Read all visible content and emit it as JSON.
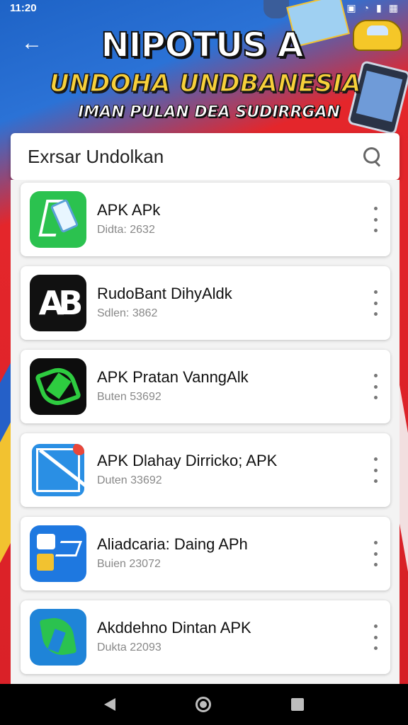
{
  "status_bar": {
    "time": "11:20",
    "icons": [
      "image-icon",
      "wifi-icon",
      "battery-icon",
      "notification-icon"
    ]
  },
  "header": {
    "back_icon": "arrow-left-icon",
    "title": "NIPOTUS A",
    "subtitle": "UNDOHA UNDBANESIA",
    "tagline": "IMAN PULAN DEA SUDIRRGAN"
  },
  "search": {
    "placeholder": "Exrsar Undolkan",
    "icon": "search-icon"
  },
  "apps": [
    {
      "name": "APK APk",
      "meta": "Didta: 2632",
      "icon": "green-phone-icon"
    },
    {
      "name": "RudoBant DihyAldk",
      "meta": "Sdlen: 3862",
      "icon": "ab-logo-icon"
    },
    {
      "name": "APK Pratan VanngAlk",
      "meta": "Buten 53692",
      "icon": "green-leaf-icon"
    },
    {
      "name": "APK Dlahay Dirricko; APK",
      "meta": "Duten 33692",
      "icon": "blue-map-icon"
    },
    {
      "name": "Aliadcaria: Daing APh",
      "meta": "Buien 23072",
      "icon": "blue-tools-icon"
    },
    {
      "name": "Akddehno Dintan APK",
      "meta": "Dukta 22093",
      "icon": "blue-leaf-icon"
    }
  ],
  "nav": {
    "back": "nav-back-icon",
    "home": "nav-home-icon",
    "recents": "nav-recents-icon"
  },
  "colors": {
    "background_red": "#d8262a",
    "banner_blue": "#1e63c6",
    "accent_yellow": "#f2c230"
  }
}
